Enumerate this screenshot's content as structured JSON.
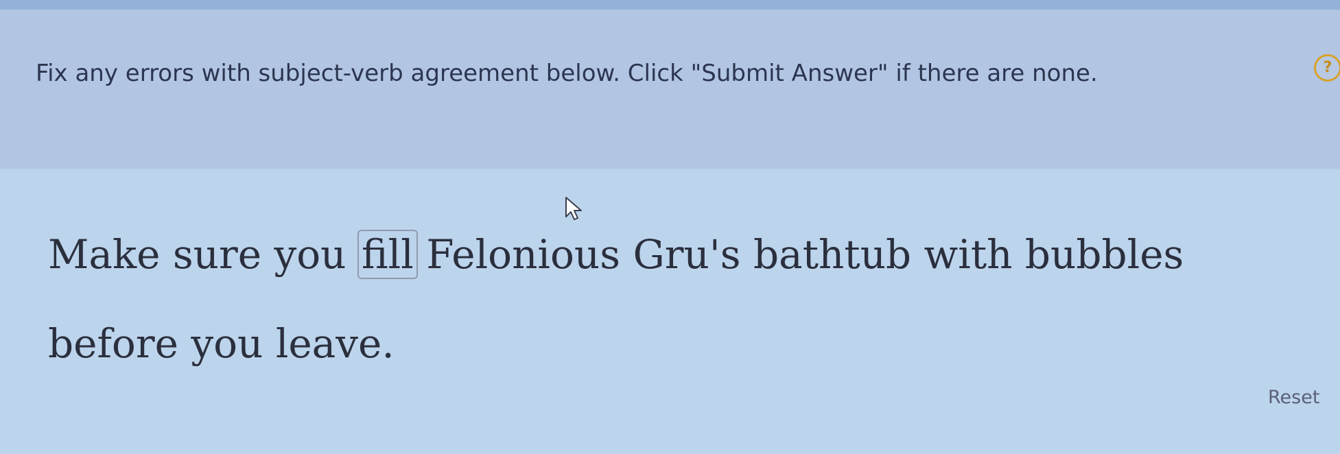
{
  "instructions": {
    "text": "Fix any errors with subject-verb agreement below. Click \"Submit Answer\" if there are none.",
    "help_icon": "question-circle-icon",
    "help_glyph": "?"
  },
  "exercise": {
    "words": [
      "Make",
      "sure",
      "you",
      "fill",
      "Felonious",
      "Gru's",
      "bathtub",
      "with",
      "bubbles",
      "before",
      "you",
      "leave."
    ],
    "selected_word": "fill"
  },
  "actions": {
    "reset_label": "Reset"
  },
  "colors": {
    "help_icon": "#d9a12b",
    "text": "#2b2f3d",
    "reset": "#5a6078"
  },
  "cursor_icon": "mouse-pointer-icon"
}
